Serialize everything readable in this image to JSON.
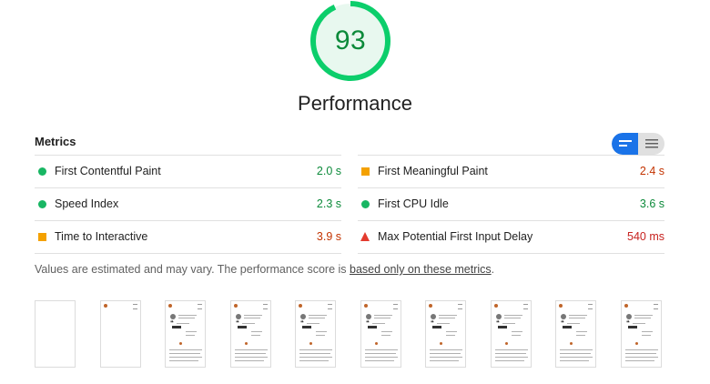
{
  "gauge": {
    "score": "93",
    "score_fraction": 0.93,
    "title": "Performance",
    "color": "#0cce6b"
  },
  "metrics": {
    "title": "Metrics",
    "toggle": {
      "left_icon": "view-compact-icon",
      "right_icon": "view-expanded-icon",
      "active": "left",
      "active_color": "#1a73e8"
    },
    "left": [
      {
        "label": "First Contentful Paint",
        "value": "2.0 s",
        "status": "pass"
      },
      {
        "label": "Speed Index",
        "value": "2.3 s",
        "status": "pass"
      },
      {
        "label": "Time to Interactive",
        "value": "3.9 s",
        "status": "average"
      }
    ],
    "right": [
      {
        "label": "First Meaningful Paint",
        "value": "2.4 s",
        "status": "average"
      },
      {
        "label": "First CPU Idle",
        "value": "3.6 s",
        "status": "pass"
      },
      {
        "label": "Max Potential First Input Delay",
        "value": "540 ms",
        "status": "fail"
      }
    ],
    "status_colors": {
      "pass": "#0c8a3a",
      "average": "#c33300",
      "fail": "#c7221f"
    }
  },
  "note": {
    "text": "Values are estimated and may vary. The performance score is ",
    "link": "based only on these metrics",
    "suffix": "."
  },
  "filmstrip": {
    "frames": [
      {
        "state": "blank"
      },
      {
        "state": "header-only"
      },
      {
        "state": "loaded"
      },
      {
        "state": "loaded"
      },
      {
        "state": "loaded"
      },
      {
        "state": "loaded"
      },
      {
        "state": "loaded"
      },
      {
        "state": "loaded"
      },
      {
        "state": "loaded"
      },
      {
        "state": "loaded"
      }
    ]
  }
}
